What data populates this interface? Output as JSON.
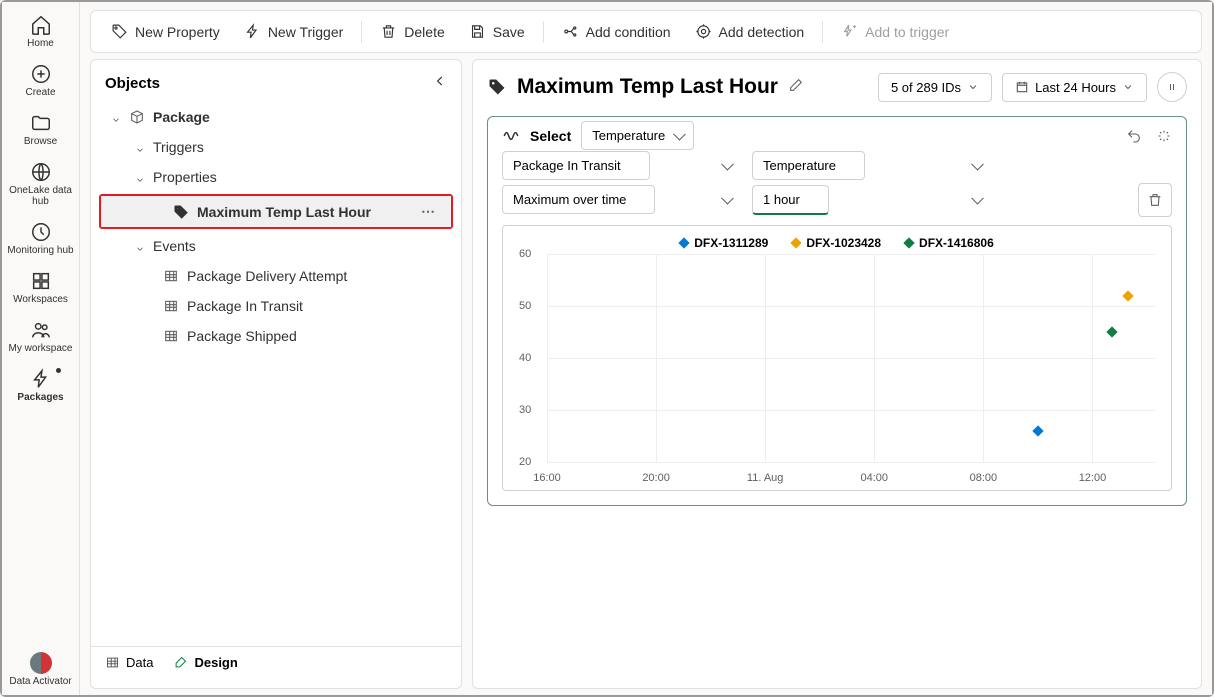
{
  "rail": {
    "items": [
      {
        "label": "Home"
      },
      {
        "label": "Create"
      },
      {
        "label": "Browse"
      },
      {
        "label": "OneLake data hub"
      },
      {
        "label": "Monitoring hub"
      },
      {
        "label": "Workspaces"
      },
      {
        "label": "My workspace"
      },
      {
        "label": "Packages"
      }
    ],
    "bottom": {
      "label": "Data Activator"
    }
  },
  "toolbar": {
    "new_property": "New Property",
    "new_trigger": "New Trigger",
    "delete": "Delete",
    "save": "Save",
    "add_condition": "Add condition",
    "add_detection": "Add detection",
    "add_to_trigger": "Add to trigger"
  },
  "objects": {
    "title": "Objects",
    "root": "Package",
    "triggers": "Triggers",
    "properties": "Properties",
    "max_temp": "Maximum Temp Last Hour",
    "events": "Events",
    "event_items": [
      "Package Delivery Attempt",
      "Package In Transit",
      "Package Shipped"
    ]
  },
  "detail": {
    "title": "Maximum Temp Last Hour",
    "ids": "5 of 289 IDs",
    "range": "Last 24 Hours",
    "select_label": "Select",
    "primary": "Temperature",
    "filter1": "Package In Transit",
    "filter2": "Temperature",
    "agg": "Maximum over time",
    "window": "1 hour"
  },
  "chart_data": {
    "type": "scatter",
    "title": "",
    "xlabel": "",
    "ylabel": "",
    "ylim": [
      20,
      60
    ],
    "yticks": [
      20,
      30,
      40,
      50,
      60
    ],
    "xticks": [
      "16:00",
      "20:00",
      "11. Aug",
      "04:00",
      "08:00",
      "12:00"
    ],
    "series": [
      {
        "name": "DFX-1311289",
        "color": "#0078d4",
        "points": [
          {
            "x": "10:00",
            "y": 26
          }
        ]
      },
      {
        "name": "DFX-1023428",
        "color": "#eaa300",
        "points": [
          {
            "x": "13:20",
            "y": 52
          }
        ]
      },
      {
        "name": "DFX-1416806",
        "color": "#107c41",
        "points": [
          {
            "x": "12:40",
            "y": 45
          }
        ]
      }
    ]
  },
  "bottom_tabs": {
    "data": "Data",
    "design": "Design"
  }
}
